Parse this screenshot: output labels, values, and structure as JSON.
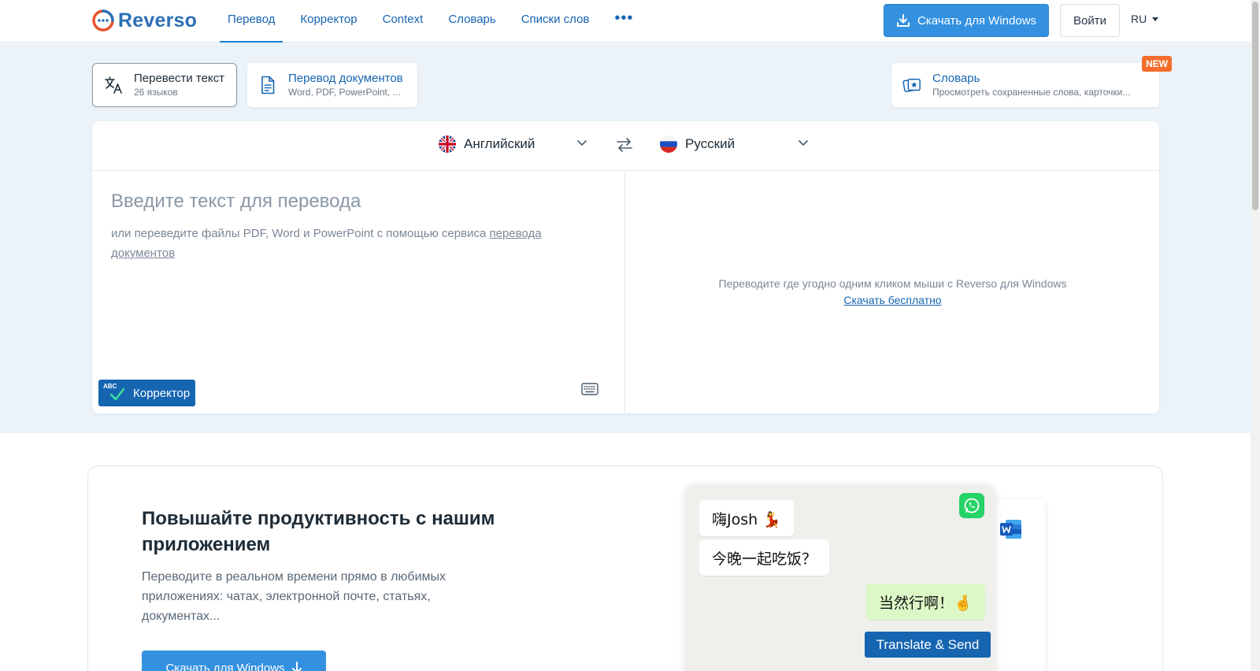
{
  "header": {
    "logo_text": "Reverso",
    "nav": [
      "Перевод",
      "Корректор",
      "Context",
      "Словарь",
      "Списки слов"
    ],
    "more": "•••",
    "download_label": "Скачать для Windows",
    "login_label": "Войти",
    "lang": "RU"
  },
  "modes": {
    "translate_text": {
      "title": "Перевести текст",
      "sub": "26 языков"
    },
    "translate_docs": {
      "title": "Перевод документов",
      "sub": "Word, PDF, PowerPoint, ..."
    },
    "dictionary": {
      "title": "Словарь",
      "sub": "Просмотреть сохраненные слова, карточки..."
    },
    "new_badge": "NEW"
  },
  "translator": {
    "source_lang": "Английский",
    "target_lang": "Русский",
    "placeholder": "Введите текст для перевода",
    "hint_prefix": "или переведите файлы PDF, Word и PowerPoint с помощью сервиса ",
    "hint_link": "перевода документов",
    "corrector_label": "Корректор",
    "corrector_badge": "ABC",
    "promo_text": "Переводите где угодно одним кликом мыши с Reverso для Windows",
    "promo_link": "Скачать бесплатно"
  },
  "promo": {
    "heading": "Повышайте продуктивность с нашим приложением",
    "text": "Переводите в реальном времени прямо в любимых приложениях: чатах, электронной почте, статьях, документах...",
    "button": "Скачать для Windows",
    "chat": {
      "msg1": "嗨Josh 💃",
      "msg2": "今晚一起吃饭？",
      "msg3": "当然行啊！🤞",
      "translate_send": "Translate & Send"
    }
  },
  "colors": {
    "brand": "#1665b1",
    "accent": "#3391e0",
    "badge": "#f46d2b",
    "band": "#ebf3f9"
  }
}
